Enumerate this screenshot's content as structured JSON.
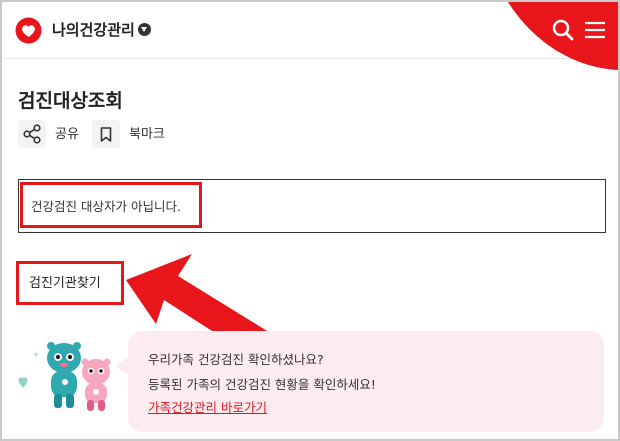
{
  "header": {
    "site_title": "나의건강관리"
  },
  "page": {
    "title": "검진대상조회",
    "share_label": "공유",
    "bookmark_label": "북마크"
  },
  "notice": {
    "text": "건강검진 대상자가 아닙니다."
  },
  "find_institution": {
    "label": "검진기관찾기"
  },
  "banner": {
    "line1": "우리가족 건강검진 확인하셨나요?",
    "line2": "등록된 가족의 건강검진 현황을 확인하세요!",
    "link": "가족건강관리 바로가기"
  },
  "colors": {
    "brand_red": "#e8151b",
    "banner_bg": "#fcecef",
    "annotation_red": "#e8151b"
  },
  "icons": [
    "heart-logo-icon",
    "chevron-down-icon",
    "search-icon",
    "hamburger-menu-icon",
    "share-icon",
    "bookmark-icon",
    "arrow-annotation",
    "mascot-illustration"
  ]
}
